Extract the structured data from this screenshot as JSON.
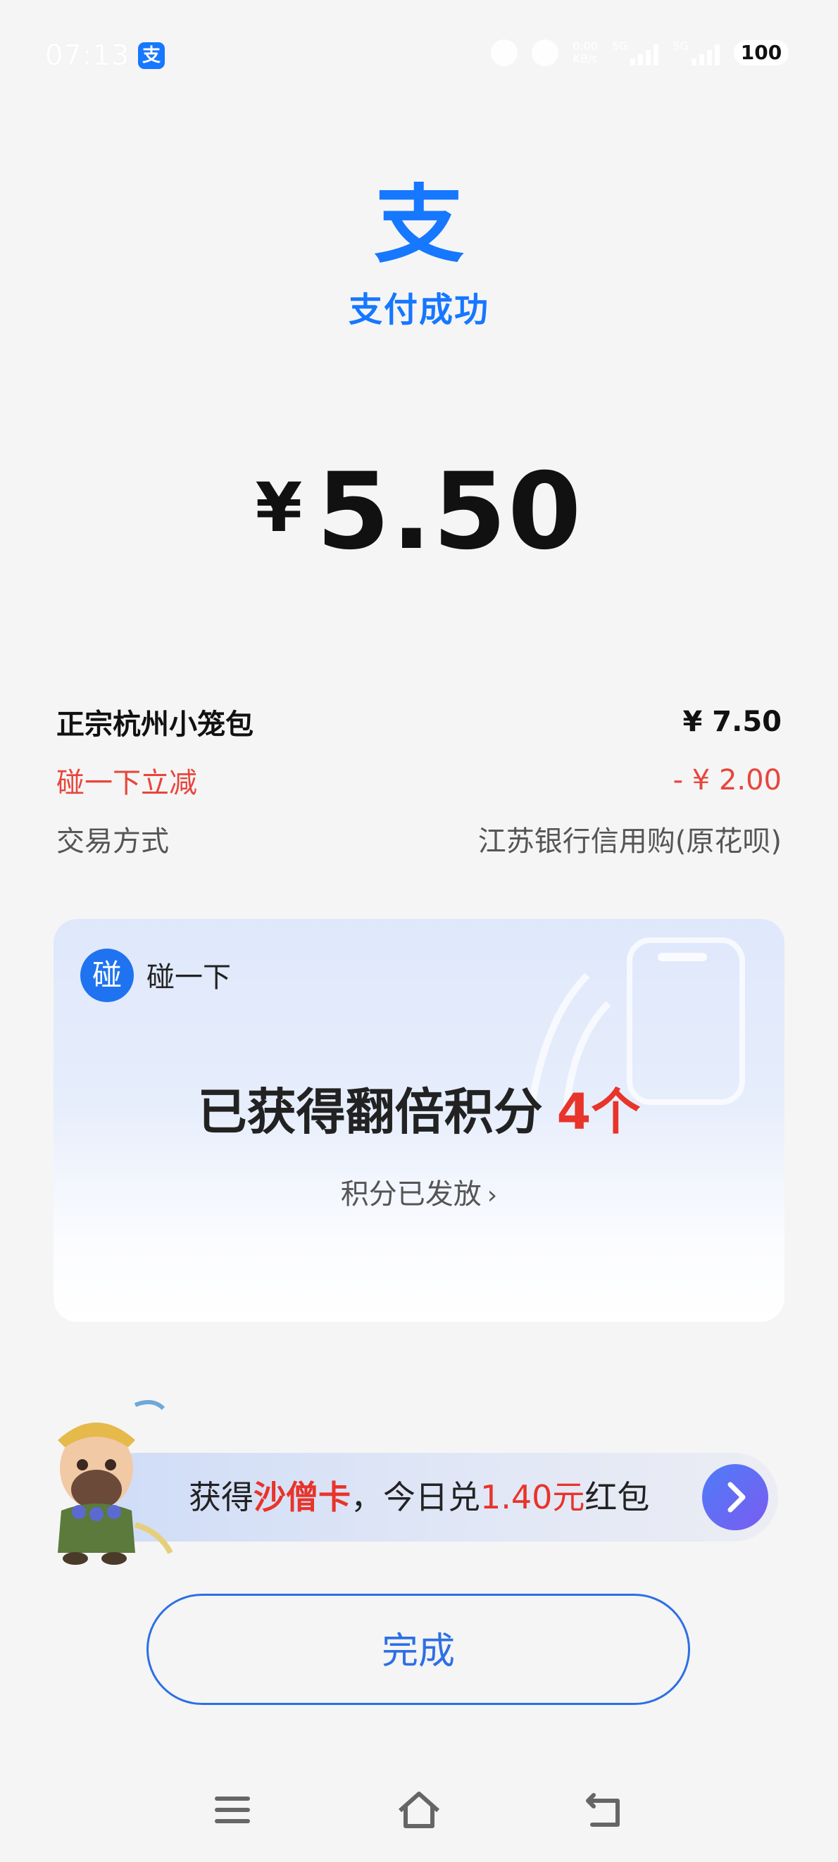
{
  "status_bar": {
    "time": "07:13",
    "app_badge": "支",
    "net_speed": "0.00\nKB/s",
    "sig1_label": "5G",
    "sig2_label": "5G",
    "battery": "100"
  },
  "header": {
    "logo_glyph": "支",
    "title": "支付成功"
  },
  "amount": {
    "currency": "¥",
    "value": "5.50"
  },
  "details": [
    {
      "label": "正宗杭州小笼包",
      "value": "¥ 7.50"
    },
    {
      "label": "碰一下立减",
      "value": "- ¥ 2.00"
    },
    {
      "label": "交易方式",
      "value": "江苏银行信用购(原花呗)"
    }
  ],
  "touch_card": {
    "badge": "碰",
    "label": "碰一下",
    "headline": "已获得翻倍积分",
    "count": "4个",
    "sub": "积分已发放",
    "sub_chevron": "›"
  },
  "banner": {
    "pre": "获得",
    "card_name": "沙僧卡",
    "mid": "，今日兑",
    "amount": "1.40元",
    "post": "红包"
  },
  "done_button": "完成",
  "nav": [
    "menu-icon",
    "home-icon",
    "back-icon"
  ],
  "colors": {
    "brand_blue": "#1677ff",
    "discount_red": "#e8453c",
    "highlight_red": "#e8342a"
  }
}
